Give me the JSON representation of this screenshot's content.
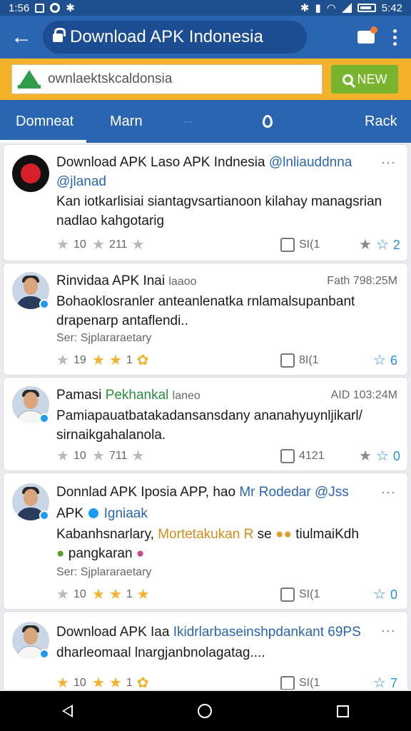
{
  "status_bar": {
    "time_left": "1:56",
    "time_right": "5:42"
  },
  "app_bar": {
    "url_title": "Download APK Indonesia"
  },
  "search": {
    "value": "ownlaektskcaldonsia",
    "new_button": "NEW"
  },
  "tabs": [
    {
      "label": "Domneat",
      "active": true
    },
    {
      "label": "Marn",
      "active": false
    },
    {
      "label": "···",
      "active": false
    },
    {
      "label": "",
      "icon": "drop-icon",
      "active": false
    },
    {
      "label": "Rack",
      "active": false
    }
  ],
  "posts": [
    {
      "name": "Download APK Laso APK Indnesia",
      "handle": "@lnliauddnna",
      "handle2": "@jlanad",
      "more": "···",
      "text": "Kan iotkarlisiai siantagvsartianoon kilahay managsrian nadlao kahgotarig",
      "actions": {
        "a1": "10",
        "a2": "211",
        "share": "SI(1",
        "star_count": "2"
      }
    },
    {
      "name": "Rinvidaa APK Inai",
      "name_extra": "laaoo",
      "time": "Fath 798:25M",
      "text": "Bohaoklosranler anteanlenatka rnlamalsupanbant drapenarp antaflendi..",
      "sub": "Ser:   Sjplararaetary",
      "actions": {
        "a1": "19",
        "a2": "1",
        "share": "8I(1",
        "star_count": "6"
      }
    },
    {
      "name": "Pamasi",
      "name_green": "Pekhankal",
      "name_extra": "laneo",
      "time": "AID 103:24M",
      "text": "Pamiapauatbatakadansansdany ananahyuynljikarl/ sirnaikgahalanola.",
      "actions": {
        "a1": "10",
        "a2": "711",
        "share": "4121",
        "star_count": "0"
      }
    },
    {
      "name": "Donnlad APK Iposia APP, hao",
      "handle": "Mr Rodedar @Jss",
      "name2": "APK",
      "handle2": "Igniaak",
      "more": "···",
      "text1": "Kabanhsnarlary,",
      "text_orange": "Mortetakukan R",
      "text2": "se",
      "text3": "tiulmaiKdh",
      "text4": "pangkaran",
      "sub": "Ser:   Sjplararaetary",
      "actions": {
        "a1": "10",
        "a2": "1",
        "share": "SI(1",
        "star_count": "0"
      }
    },
    {
      "name": "Download APK Iaa",
      "handle": "Ikidrlarbaseinshpdankant 69PS",
      "more": "···",
      "text": "dharleomaal lnargjanbnolagatag....",
      "actions": {
        "a1": "10",
        "a2": "1",
        "share": "SI(1",
        "star_count": "7"
      }
    }
  ]
}
